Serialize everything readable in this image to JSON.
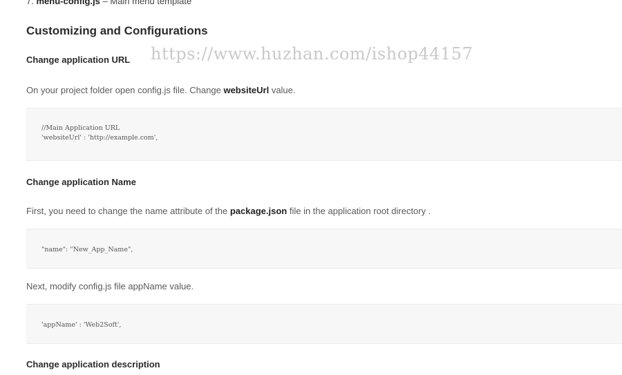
{
  "list_item": {
    "number": "7.",
    "filename": "menu-config.js",
    "description": "– Main menu template"
  },
  "section_title": "Customizing and Configurations",
  "url_section": {
    "title": "Change application URL",
    "intro_before": "On your project folder open config.js file. Change ",
    "intro_bold": "websiteUrl",
    "intro_after": " value.",
    "code": [
      "//Main Application URL",
      "'websiteUrl' : 'http://example.com',"
    ]
  },
  "watermark": "https://www.huzhan.com/ishop44157",
  "name_section": {
    "title": "Change application Name",
    "intro_before": "First, you need to change the name attribute of the ",
    "intro_bold": "package.json",
    "intro_after": " file in the application root directory .",
    "code_1": "\"name\": \"New_App_Name\",",
    "next_text": "Next, modify config.js file appName value.",
    "code_2": "'appName' : 'Web2Soft',"
  },
  "description_section": {
    "title": "Change application description"
  }
}
